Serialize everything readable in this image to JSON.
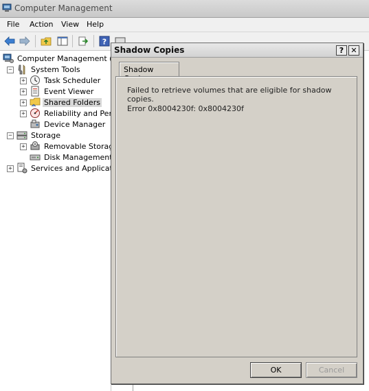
{
  "window": {
    "title": "Computer Management"
  },
  "menu": {
    "items": [
      "File",
      "Action",
      "View",
      "Help"
    ]
  },
  "toolbar": {
    "icons": [
      "back-arrow-icon",
      "forward-arrow-icon",
      "up-folder-icon",
      "show-hide-tree-icon",
      "export-list-icon",
      "help-icon",
      "properties-icon"
    ]
  },
  "tree": {
    "root": "Computer Management (Loc",
    "system_tools": "System Tools",
    "task_scheduler": "Task Scheduler",
    "event_viewer": "Event Viewer",
    "shared_folders": "Shared Folders",
    "reliability": "Reliability and Perfor",
    "device_manager": "Device Manager",
    "storage": "Storage",
    "removable_storage": "Removable Storage",
    "disk_management": "Disk Management",
    "services": "Services and Application",
    "expanded_glyph": "−",
    "collapsed_glyph": "+"
  },
  "dialog": {
    "title": "Shadow Copies",
    "help_glyph": "?",
    "close_glyph": "✕",
    "tab_label": "Shadow Copies",
    "message": "Failed to retrieve volumes that are eligible for shadow copies.",
    "error": "Error 0x8004230f: 0x8004230f",
    "ok_label": "OK",
    "cancel_label": "Cancel"
  }
}
